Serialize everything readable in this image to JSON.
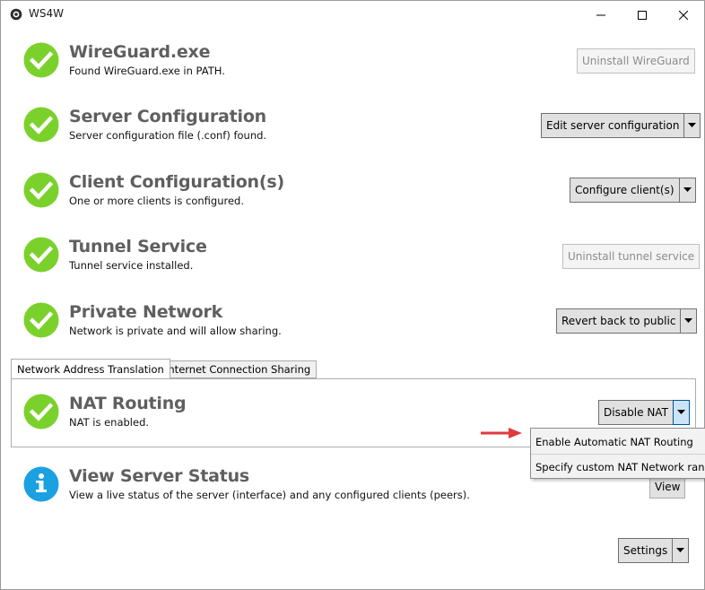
{
  "window": {
    "title": "WS4W"
  },
  "rows": [
    {
      "title": "WireGuard.exe",
      "desc": "Found WireGuard.exe in PATH.",
      "status": "ok",
      "action": "Uninstall WireGuard"
    },
    {
      "title": "Server Configuration",
      "desc": "Server configuration file (.conf) found.",
      "status": "ok",
      "action": "Edit server configuration"
    },
    {
      "title": "Client Configuration(s)",
      "desc": "One or more clients is configured.",
      "status": "ok",
      "action": "Configure client(s)"
    },
    {
      "title": "Tunnel Service",
      "desc": "Tunnel service installed.",
      "status": "ok",
      "action": "Uninstall tunnel service"
    },
    {
      "title": "Private Network",
      "desc": "Network is private and will allow sharing.",
      "status": "ok",
      "action": "Revert back to public"
    }
  ],
  "tabs": [
    {
      "label": "Network Address Translation",
      "selected": true
    },
    {
      "label": "Internet Connection Sharing",
      "selected": false
    }
  ],
  "nat": {
    "title": "NAT Routing",
    "desc": "NAT is enabled.",
    "status": "ok",
    "action": "Disable NAT"
  },
  "nat_menu": [
    "Enable Automatic NAT Routing",
    "Specify custom NAT Network range"
  ],
  "server_status": {
    "title": "View Server Status",
    "desc": "View a live status of the server (interface) and any configured clients (peers).",
    "status": "info",
    "action": "View"
  },
  "settings": {
    "label": "Settings"
  },
  "colors": {
    "ok": "#7bd12c",
    "info": "#1ba1e2",
    "arrow": "#e0393e"
  },
  "icons": {
    "ok": "check-circle-icon",
    "info": "info-circle-icon"
  }
}
